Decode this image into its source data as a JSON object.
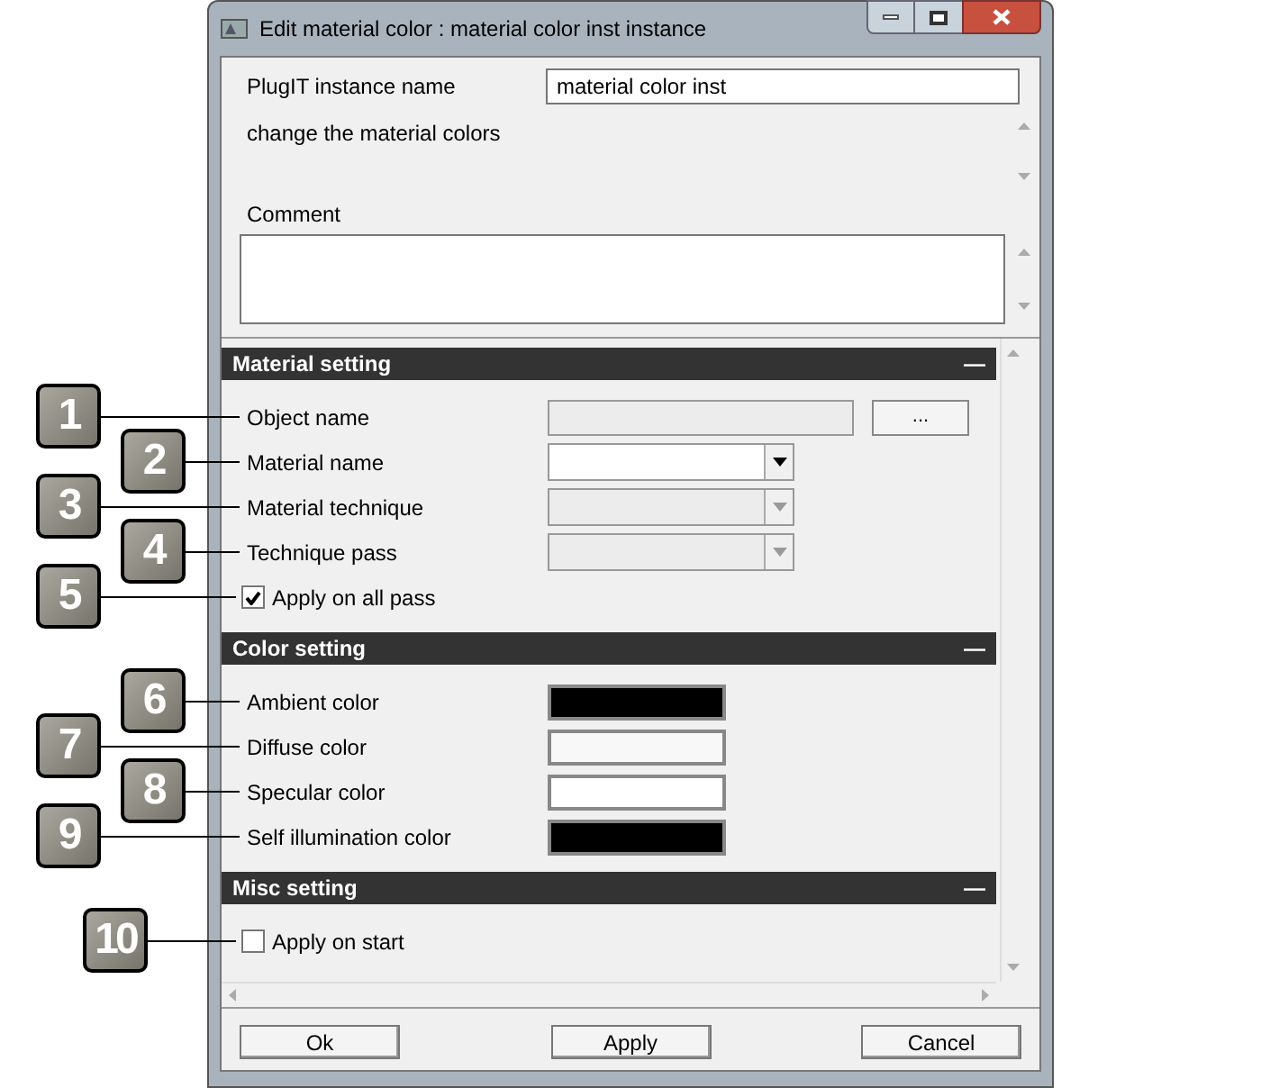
{
  "window": {
    "title": "Edit material color : material color inst instance"
  },
  "instance_name": {
    "label": "PlugIT instance name",
    "value": "material color inst"
  },
  "description": "change the material colors",
  "comment": {
    "label": "Comment"
  },
  "sections": [
    {
      "title": "Material setting",
      "collapse": "—",
      "rows": [
        {
          "kind": "text_field",
          "label": "Object name",
          "callout": "1",
          "disabled": true,
          "button": "..."
        },
        {
          "kind": "combo",
          "label": "Material name",
          "callout": "2",
          "disabled": false
        },
        {
          "kind": "combo",
          "label": "Material technique",
          "callout": "3",
          "disabled": true
        },
        {
          "kind": "combo",
          "label": "Technique pass",
          "callout": "4",
          "disabled": true
        },
        {
          "kind": "checkbox",
          "label": "Apply on all pass",
          "callout": "5",
          "checked": true
        }
      ]
    },
    {
      "title": "Color setting",
      "collapse": "—",
      "rows": [
        {
          "kind": "color",
          "label": "Ambient color",
          "callout": "6",
          "color": "#000000"
        },
        {
          "kind": "color",
          "label": "Diffuse color",
          "callout": "7",
          "color": "#f8f8f8"
        },
        {
          "kind": "color",
          "label": "Specular color",
          "callout": "8",
          "color": "#ffffff"
        },
        {
          "kind": "color",
          "label": "Self illumination color",
          "callout": "9",
          "color": "#000000"
        }
      ]
    },
    {
      "title": "Misc setting",
      "collapse": "—",
      "rows": [
        {
          "kind": "checkbox",
          "label": "Apply on start",
          "callout": "10",
          "checked": false
        }
      ]
    }
  ],
  "buttons": [
    "Ok",
    "Apply",
    "Cancel"
  ]
}
